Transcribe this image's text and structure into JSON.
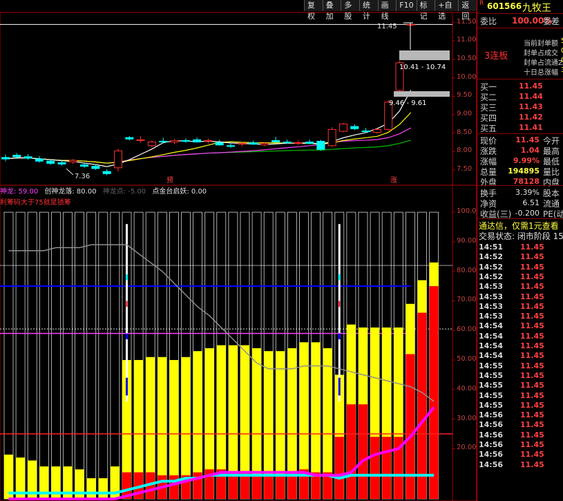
{
  "toolbar": [
    "复权",
    "叠加",
    "多股",
    "统计",
    "画线",
    "F10",
    "标记",
    "+自选",
    "返回"
  ],
  "stock": {
    "market_flag": "R",
    "code": "601566",
    "name": "九牧王"
  },
  "weibi": {
    "label": "委比",
    "value": "100.00%",
    "suffix": "委差"
  },
  "seal": {
    "lines": [
      "当前封单额",
      "封单占成交",
      "封单占流通Z",
      "十日总涨幅"
    ],
    "trail": [
      "5",
      "0",
      "0",
      "3"
    ],
    "board_label": "3连板"
  },
  "bids": [
    {
      "label": "买一",
      "price": "11.45"
    },
    {
      "label": "买二",
      "price": "11.44"
    },
    {
      "label": "买三",
      "price": "11.43"
    },
    {
      "label": "买四",
      "price": "11.42"
    },
    {
      "label": "买五",
      "price": "11.41"
    }
  ],
  "quote": [
    {
      "label": "现价",
      "value": "11.45",
      "suffix": "今开",
      "color": "#ff4040"
    },
    {
      "label": "涨跌",
      "value": "1.04",
      "suffix": "最高",
      "color": "#ff4040"
    },
    {
      "label": "涨幅",
      "value": "9.99%",
      "suffix": "最低",
      "color": "#ff4040"
    },
    {
      "label": "总量",
      "value": "194895",
      "suffix": "量比",
      "color": "#ffff40"
    },
    {
      "label": "外盘",
      "value": "78128",
      "suffix": "内盘",
      "color": "#ff4040"
    }
  ],
  "stats": [
    {
      "label": "换手",
      "value": "3.39%",
      "suffix": "股本"
    },
    {
      "label": "净资",
      "value": "6.51",
      "suffix": "流通"
    },
    {
      "label": "收益(三)",
      "value": "-0.200",
      "suffix": "PE(动"
    }
  ],
  "ad": "通达信，仅需1元查看",
  "trade_status": "交易状态: 闭市阶段 15",
  "ticks": [
    {
      "time": "14:51",
      "price": "11.45"
    },
    {
      "time": "14:52",
      "price": "11.45"
    },
    {
      "time": "14:52",
      "price": "11.45"
    },
    {
      "time": "14:52",
      "price": "11.45"
    },
    {
      "time": "14:53",
      "price": "11.45"
    },
    {
      "time": "14:53",
      "price": "11.45"
    },
    {
      "time": "14:53",
      "price": "11.45"
    },
    {
      "time": "14:53",
      "price": "11.45"
    },
    {
      "time": "14:54",
      "price": "11.45"
    },
    {
      "time": "14:54",
      "price": "11.45"
    },
    {
      "time": "14:54",
      "price": "11.45"
    },
    {
      "time": "14:54",
      "price": "11.45"
    },
    {
      "time": "14:55",
      "price": "11.45"
    },
    {
      "time": "14:55",
      "price": "11.45"
    },
    {
      "time": "14:55",
      "price": "11.45"
    },
    {
      "time": "14:55",
      "price": "11.45"
    },
    {
      "time": "14:55",
      "price": "11.45"
    },
    {
      "time": "14:56",
      "price": "11.45"
    },
    {
      "time": "14:56",
      "price": "11.45"
    },
    {
      "time": "14:56",
      "price": "11.45"
    },
    {
      "time": "14:56",
      "price": "11.45"
    },
    {
      "time": "14:56",
      "price": "11.45"
    },
    {
      "time": "14:56",
      "price": "11.45"
    }
  ],
  "indicator_legend": [
    {
      "text": "神龙: 59.00",
      "color": "#ff40ff"
    },
    {
      "text": "创神龙落: 80.00",
      "color": "#e0e0e0"
    },
    {
      "text": "神龙点: -5.00",
      "color": "#606060"
    },
    {
      "text": "点金台启妖: 0.00",
      "color": "#e0e0e0"
    }
  ],
  "indicator_note": "利筹码大于75就是锁筹",
  "colors": {
    "up": "#ff3030",
    "down": "#00ffff",
    "ma5": "#ffffff",
    "ma10": "#ffff00",
    "ma20": "#ff40ff",
    "ma60": "#00c000",
    "vol_yellow": "#ffff00",
    "vol_red": "#ff0000",
    "line_cyan": "#00ffff",
    "line_magenta": "#ff00ff",
    "line_gray": "#909090",
    "blue_line": "#0000ff",
    "mag_line": "#ff40ff",
    "red_line": "#ff2020"
  },
  "chart_data": [
    {
      "type": "candlestick",
      "y_ticks": [
        "11.50",
        "11.00",
        "10.50",
        "10.00",
        "9.50",
        "9.00",
        "8.50",
        "8.00",
        "7.50"
      ],
      "ylim": [
        7.2,
        11.7
      ],
      "candles": [
        [
          7.84,
          7.92,
          7.74,
          7.8
        ],
        [
          7.9,
          7.96,
          7.8,
          7.86
        ],
        [
          7.86,
          7.93,
          7.78,
          7.82
        ],
        [
          7.8,
          7.88,
          7.7,
          7.74
        ],
        [
          7.74,
          7.8,
          7.64,
          7.68
        ],
        [
          7.7,
          7.78,
          7.62,
          7.66
        ],
        [
          7.72,
          7.8,
          7.66,
          7.76
        ],
        [
          7.64,
          7.7,
          7.56,
          7.6
        ],
        [
          7.6,
          7.66,
          7.5,
          7.54
        ],
        [
          7.46,
          7.52,
          7.36,
          7.4
        ],
        [
          7.56,
          8.08,
          7.46,
          8.02
        ],
        [
          8.38,
          8.42,
          8.3,
          8.34
        ],
        [
          8.3,
          8.42,
          8.24,
          8.32
        ],
        [
          8.16,
          8.3,
          8.12,
          8.26
        ],
        [
          8.28,
          8.38,
          8.22,
          8.26
        ],
        [
          8.26,
          8.34,
          8.2,
          8.3
        ],
        [
          8.3,
          8.36,
          8.24,
          8.28
        ],
        [
          8.32,
          8.38,
          8.24,
          8.26
        ],
        [
          8.28,
          8.36,
          8.22,
          8.3
        ],
        [
          8.24,
          8.32,
          8.16,
          8.18
        ],
        [
          8.16,
          8.22,
          8.1,
          8.14
        ],
        [
          8.2,
          8.26,
          8.14,
          8.22
        ],
        [
          8.24,
          8.3,
          8.18,
          8.2
        ],
        [
          8.18,
          8.26,
          8.14,
          8.22
        ],
        [
          8.3,
          8.4,
          8.24,
          8.26
        ],
        [
          8.26,
          8.32,
          8.22,
          8.24
        ],
        [
          8.22,
          8.3,
          8.18,
          8.24
        ],
        [
          8.26,
          8.32,
          8.2,
          8.22
        ],
        [
          8.28,
          8.32,
          8.02,
          8.06
        ],
        [
          8.16,
          8.66,
          8.12,
          8.6
        ],
        [
          8.55,
          8.78,
          8.52,
          8.75
        ],
        [
          8.68,
          8.74,
          8.58,
          8.62
        ],
        [
          8.56,
          8.64,
          8.5,
          8.54
        ],
        [
          8.52,
          8.62,
          8.48,
          8.6
        ],
        [
          8.6,
          9.4,
          8.56,
          9.34
        ],
        [
          9.66,
          10.46,
          9.61,
          10.41
        ],
        [
          11.45,
          11.45,
          11.45,
          11.45
        ]
      ],
      "annotations": [
        "11.45",
        "10.41 - 10.74",
        "9.46 - 9.61",
        "7.36",
        "预",
        "涨"
      ]
    },
    {
      "type": "bar",
      "y_ticks": [
        "100.0",
        "90.00",
        "80.00",
        "70.00",
        "60.00",
        "50.00",
        "40.00",
        "30.00",
        "20.00"
      ],
      "ylim": [
        3,
        104
      ],
      "yellow": [
        18,
        17,
        16,
        14,
        14,
        14,
        13,
        10,
        10,
        14,
        50,
        50,
        51,
        51,
        50,
        51,
        53,
        54,
        55,
        55,
        55,
        54,
        53,
        53,
        54,
        56,
        56,
        54,
        45,
        62,
        61,
        61,
        61,
        61,
        69,
        77,
        83
      ],
      "red": [
        0,
        0,
        0,
        0,
        0,
        0,
        0,
        0,
        0,
        0,
        12,
        12,
        12,
        11,
        11,
        11,
        12,
        13,
        13,
        12,
        12,
        11,
        11,
        11,
        12,
        13,
        12,
        12,
        24,
        35,
        35,
        24,
        24,
        24,
        52,
        66,
        75
      ],
      "gray_line": [
        87,
        87,
        87,
        87,
        88,
        88,
        88,
        89,
        89,
        89,
        89,
        86,
        83,
        80,
        76,
        72,
        68,
        65,
        61,
        57,
        53,
        49,
        47,
        47,
        47,
        48,
        48,
        48,
        47,
        46,
        45,
        44,
        43,
        42,
        41,
        39,
        36
      ],
      "magenta_line": [
        3,
        3,
        3,
        3,
        3,
        3,
        3,
        3,
        3,
        3,
        4,
        5,
        6,
        7,
        8,
        9,
        10,
        11,
        12,
        12,
        12,
        12,
        12,
        12,
        12,
        12,
        11,
        11,
        11,
        12,
        16,
        18,
        19,
        20,
        24,
        29,
        34
      ],
      "cyan_line": [
        5,
        5,
        5,
        5,
        5,
        5,
        5,
        5,
        5,
        5,
        6,
        7,
        8,
        9,
        9,
        10,
        10,
        11,
        11,
        11,
        11,
        11,
        11,
        11,
        11,
        11,
        11,
        11,
        10,
        11,
        11,
        11,
        11,
        11,
        11,
        11,
        11
      ],
      "h_lines": [
        75,
        59,
        25
      ]
    }
  ]
}
